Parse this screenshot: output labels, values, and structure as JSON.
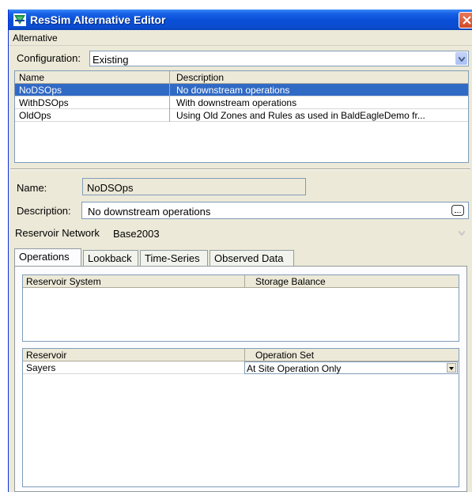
{
  "window": {
    "title": "ResSim Alternative Editor"
  },
  "menubar": {
    "items": [
      "Alternative"
    ]
  },
  "configuration": {
    "label": "Configuration:",
    "value": "Existing"
  },
  "alternatives_table": {
    "headers": [
      "Name",
      "Description"
    ],
    "rows": [
      {
        "name": "NoDSOps",
        "description": "No downstream operations",
        "selected": true
      },
      {
        "name": "WithDSOps",
        "description": "With downstream operations",
        "selected": false
      },
      {
        "name": "OldOps",
        "description": "Using Old Zones and Rules as used in BaldEagleDemo fr...",
        "selected": false
      }
    ]
  },
  "details": {
    "name_label": "Name:",
    "name_value": "NoDSOps",
    "description_label": "Description:",
    "description_value": "No downstream operations",
    "network_label": "Reservoir Network",
    "network_value": "Base2003"
  },
  "tabs": [
    {
      "label": "Operations",
      "active": true
    },
    {
      "label": "Lookback",
      "active": false
    },
    {
      "label": "Time-Series",
      "active": false
    },
    {
      "label": "Observed Data",
      "active": false
    }
  ],
  "system_table": {
    "headers": [
      "Reservoir System",
      "Storage Balance"
    ]
  },
  "reservoir_table": {
    "headers": [
      "Reservoir",
      "Operation Set"
    ],
    "rows": [
      {
        "reservoir": "Sayers",
        "operation_set": "At Site Operation Only"
      }
    ]
  },
  "colors": {
    "title_bar": "#0a4fd8",
    "selection": "#316ac5",
    "window_bg": "#ece9d8",
    "close_button": "#d04a26"
  },
  "icons": [
    "ressim-app-icon",
    "close-icon",
    "chevron-down-icon",
    "ellipsis-button-icon"
  ]
}
